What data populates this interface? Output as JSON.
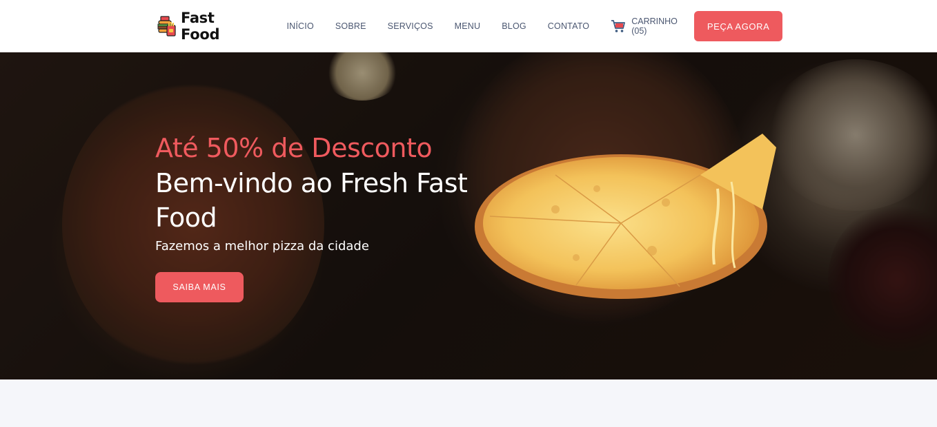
{
  "brand": {
    "name": "Fast Food",
    "logo_icon": "fast-food-logo-icon"
  },
  "nav": {
    "items": [
      {
        "label": "INÍCIO"
      },
      {
        "label": "SOBRE"
      },
      {
        "label": "SERVIÇOS"
      },
      {
        "label": "MENU"
      },
      {
        "label": "BLOG"
      },
      {
        "label": "CONTATO"
      }
    ],
    "cart": {
      "icon": "cart-icon",
      "label": "CARRINHO (05)"
    },
    "order_button": "PEÇA AGORA"
  },
  "hero": {
    "promo": "Até 50% de Desconto",
    "title": "Bem-vindo ao Fresh Fast Food",
    "subtitle": "Fazemos a melhor pizza da cidade",
    "button": "SAIBA MAIS",
    "image": "cheese-pizza-image"
  },
  "colors": {
    "accent": "#ee5a5e",
    "nav_text": "#4a5670",
    "section_bg": "#f5f6fa"
  }
}
